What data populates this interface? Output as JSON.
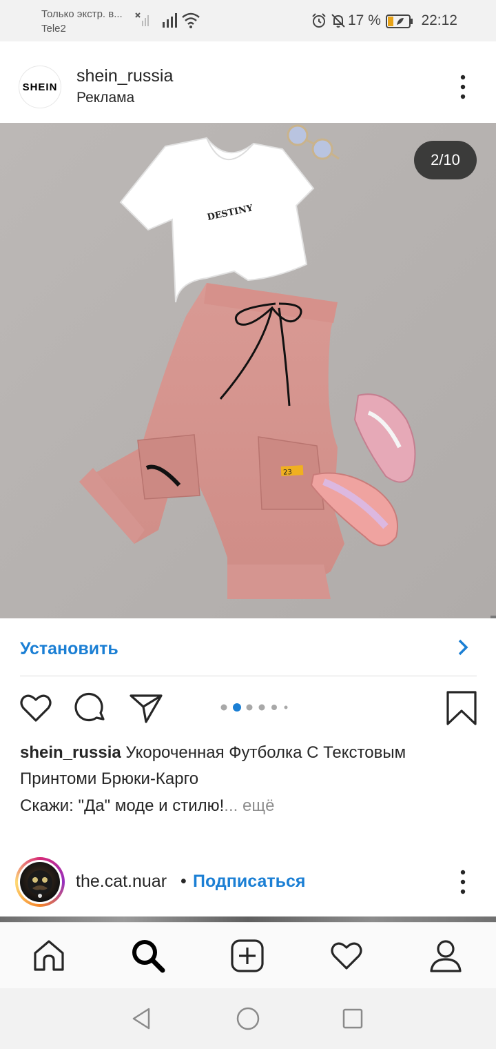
{
  "status_bar": {
    "carrier_notice": "Только экстр. в...",
    "carrier": "Tele2",
    "battery_percent": "17 %",
    "time": "22:12"
  },
  "post": {
    "username": "shein_russia",
    "sponsored": "Реклама",
    "brand_logo_text": "SHEIN",
    "page_counter": "2/10",
    "install_label": "Установить",
    "caption_username": "shein_russia",
    "caption_text": "Укороченная Футболка С Текстовым Принтоми Брюки-Карго",
    "caption_line2": "Скажи: \"Да\" моде и стилю!",
    "caption_more": "... ещё",
    "carousel": {
      "total_dots": 6,
      "active_index": 1
    },
    "product_print": "DESTINY",
    "patch_text": "23"
  },
  "next_post": {
    "username": "the.cat.nuar",
    "separator": "•",
    "follow_label": "Подписаться"
  },
  "icons": {
    "like": "heart-outline-icon",
    "comment": "comment-bubble-icon",
    "share": "paper-plane-icon",
    "save": "bookmark-icon",
    "nav_home": "home-icon",
    "nav_search": "search-icon",
    "nav_add": "add-post-icon",
    "nav_activity": "heart-icon",
    "nav_profile": "profile-icon"
  },
  "colors": {
    "link_blue": "#1b7fd4",
    "image_background": "#b7b3b1"
  }
}
